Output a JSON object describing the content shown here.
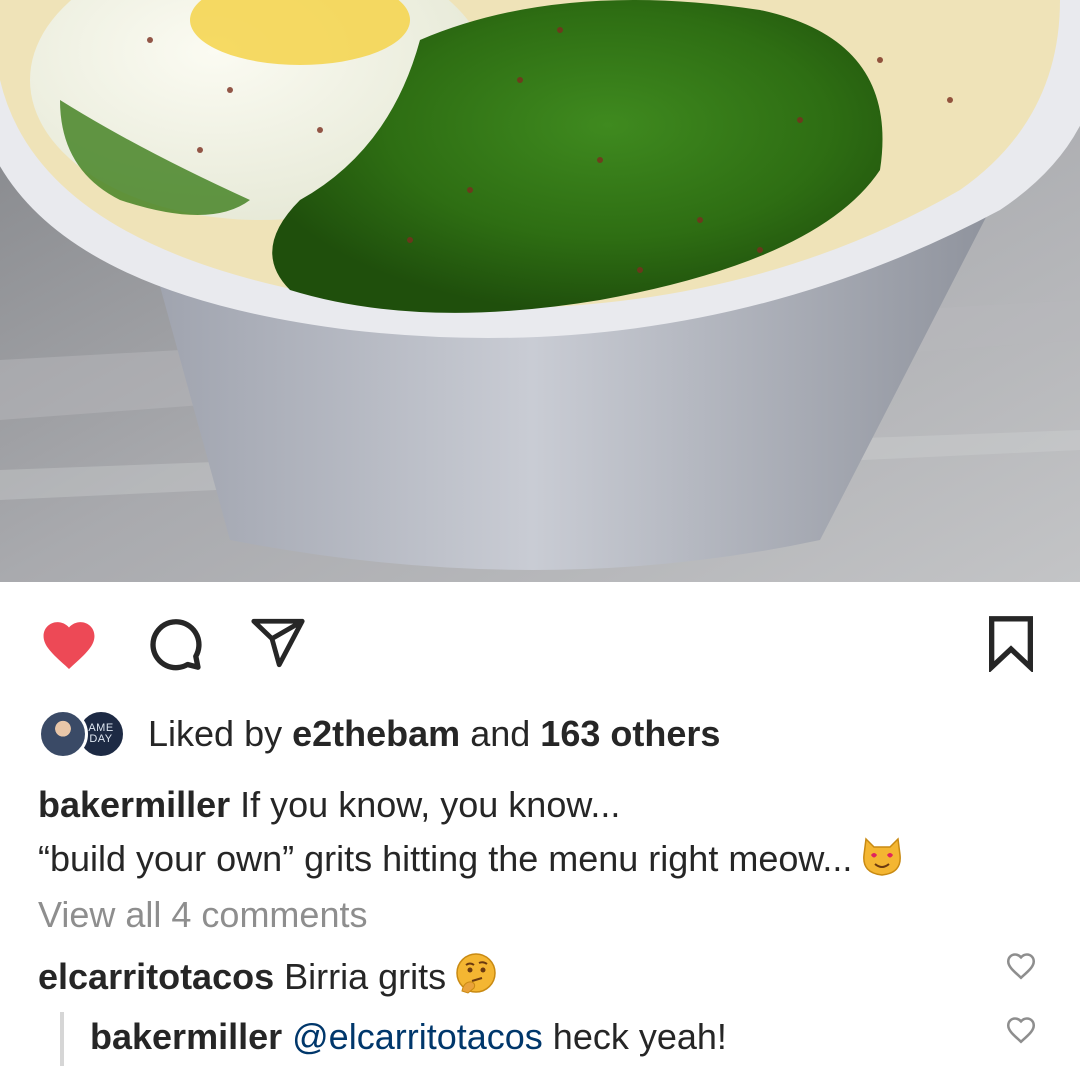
{
  "post": {
    "liked_by_prefix": "Liked by",
    "liked_by_user": "e2thebam",
    "liked_by_and": "and",
    "liked_by_others": "163 others",
    "avatar_badge_text": "AME DAY"
  },
  "caption": {
    "username": "bakermiller",
    "line1": "If you know, you know...",
    "line2": "“build your own” grits hitting the menu right meow...",
    "emoji": "heart-eyes-cat"
  },
  "comments": {
    "view_all": "View all 4 comments",
    "items": [
      {
        "username": "elcarritotacos",
        "text": "Birria grits",
        "emoji": "thinking-face"
      },
      {
        "username": "bakermiller",
        "mention": "@elcarritotacos",
        "text": "heck yeah!"
      }
    ]
  },
  "icons": {
    "like": "heart-icon",
    "comment": "comment-icon",
    "share": "paper-plane-icon",
    "save": "bookmark-icon"
  },
  "colors": {
    "like_red": "#ed4956",
    "text": "#262626",
    "muted": "#8e8e8e",
    "mention": "#00376b"
  }
}
